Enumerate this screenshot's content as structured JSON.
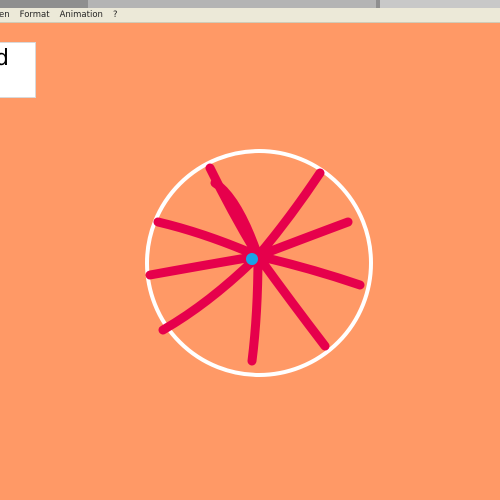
{
  "menubar": {
    "items": [
      {
        "label": "en"
      },
      {
        "label": "Format"
      },
      {
        "label": "Animation"
      },
      {
        "label": "?"
      }
    ]
  },
  "canvas": {
    "background_color": "#ff9966",
    "text_box": {
      "text": "d"
    }
  },
  "drawing": {
    "circle_color": "#ffffff",
    "spoke_color": "#e6004c",
    "spoke_count": 10,
    "center_dot_color": "#1aa3e8"
  }
}
